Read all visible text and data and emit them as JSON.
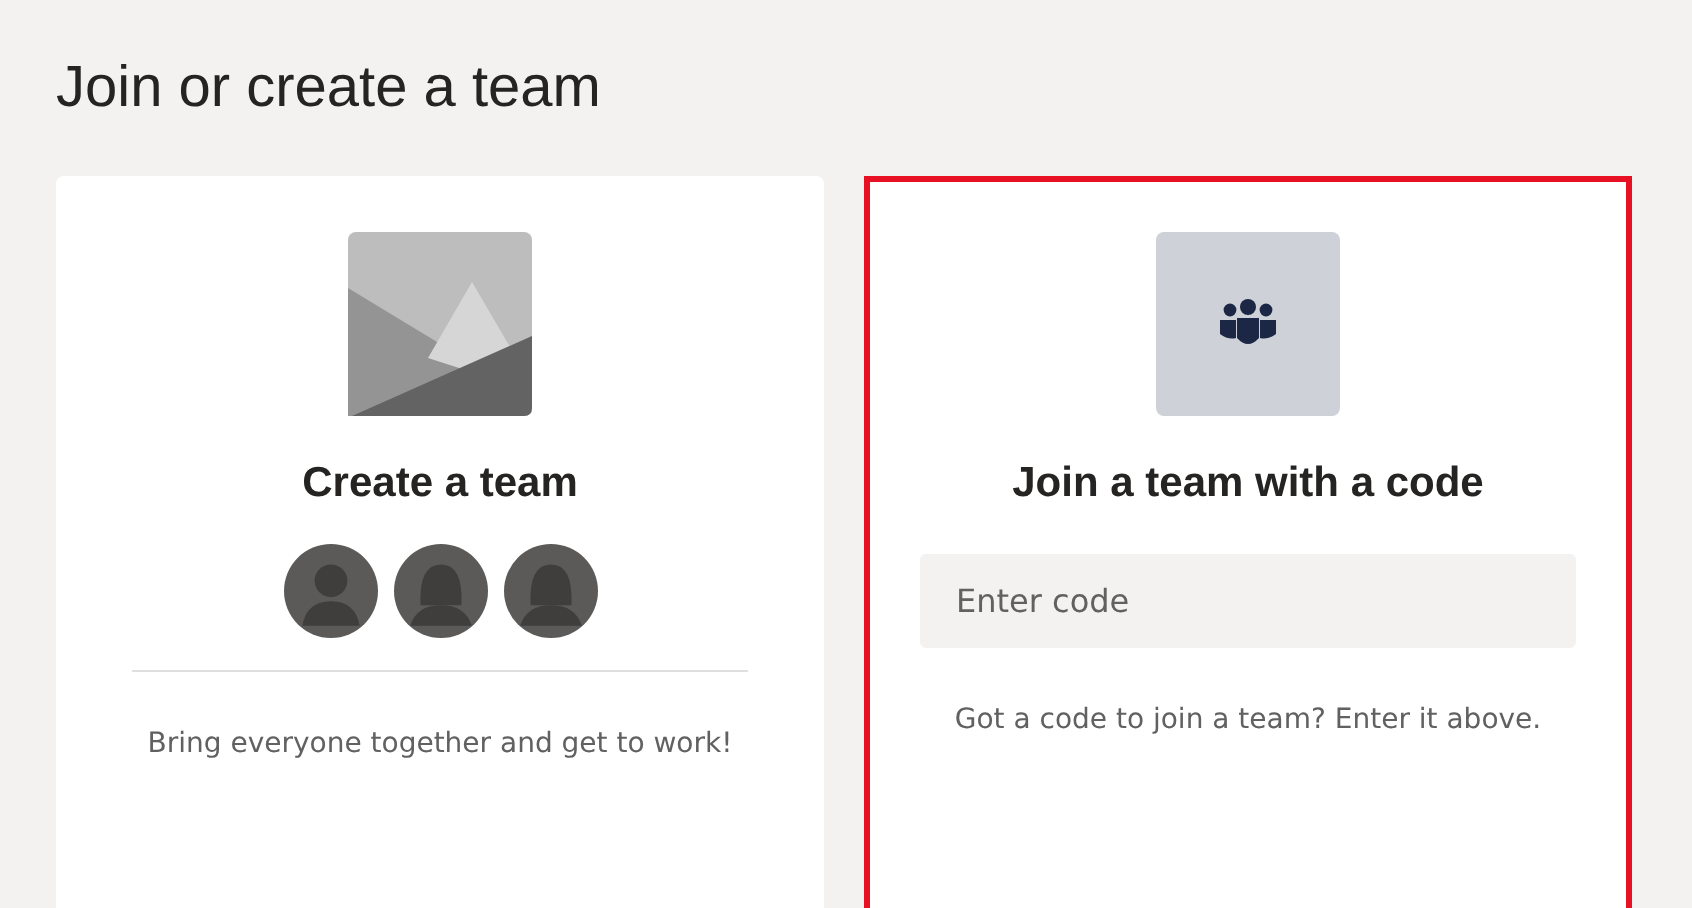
{
  "page": {
    "title": "Join or create a team"
  },
  "cards": [
    {
      "kind": "create",
      "selected": false,
      "title": "Create a team",
      "description": "Bring everyone together and get to work!"
    },
    {
      "kind": "join",
      "selected": true,
      "title": "Join a team with a code",
      "placeholder": "Enter code",
      "description": "Got a code to join a team? Enter it above."
    }
  ]
}
